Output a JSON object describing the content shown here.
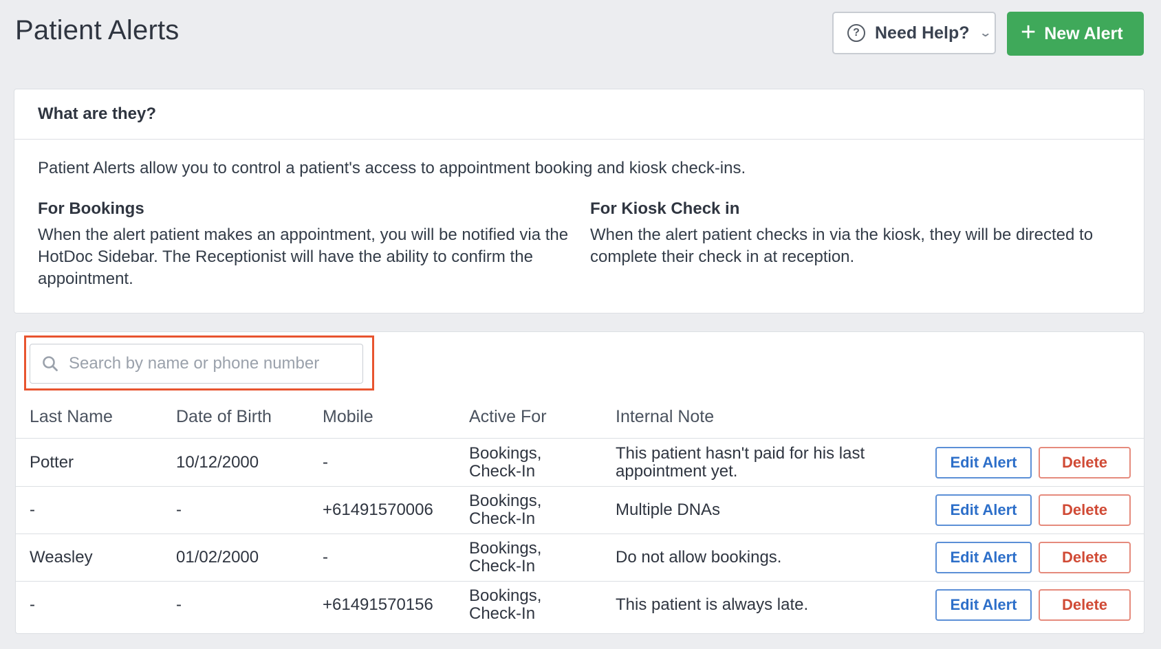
{
  "page": {
    "title": "Patient Alerts"
  },
  "header_actions": {
    "help_label": "Need Help?",
    "new_alert_label": "New Alert"
  },
  "info": {
    "header": "What are they?",
    "intro": "Patient Alerts allow you to control a patient's access to appointment booking and kiosk check-ins.",
    "bookings": {
      "heading": "For Bookings",
      "text": "When the alert patient makes an appointment, you will be notified via the HotDoc Sidebar. The Receptionist will have the ability to confirm the appointment."
    },
    "kiosk": {
      "heading": "For Kiosk Check in",
      "text": "When the alert patient checks in via the kiosk, they will be directed to complete their check in at reception."
    }
  },
  "search": {
    "placeholder": "Search by name or phone number",
    "value": ""
  },
  "table": {
    "columns": [
      "Last Name",
      "Date of Birth",
      "Mobile",
      "Active For",
      "Internal Note"
    ],
    "rows": [
      {
        "last_name": "Potter",
        "dob": "10/12/2000",
        "mobile": "-",
        "active_for": [
          "Bookings,",
          "Check-In"
        ],
        "note": "This patient hasn't paid for his last appointment yet.",
        "edit_label": "Edit Alert",
        "delete_label": "Delete"
      },
      {
        "last_name": "-",
        "dob": "-",
        "mobile": "+61491570006",
        "active_for": [
          "Bookings,",
          "Check-In"
        ],
        "note": "Multiple DNAs",
        "edit_label": "Edit Alert",
        "delete_label": "Delete"
      },
      {
        "last_name": "Weasley",
        "dob": "01/02/2000",
        "mobile": "-",
        "active_for": [
          "Bookings,",
          "Check-In"
        ],
        "note": "Do not allow bookings.",
        "edit_label": "Edit Alert",
        "delete_label": "Delete"
      },
      {
        "last_name": "-",
        "dob": "-",
        "mobile": "+61491570156",
        "active_for": [
          "Bookings,",
          "Check-In"
        ],
        "note": "This patient is always late.",
        "edit_label": "Edit Alert",
        "delete_label": "Delete"
      }
    ]
  },
  "colors": {
    "primary_green": "#3fa95a",
    "edit_blue": "#2d6fc9",
    "delete_red": "#d04a35",
    "highlight_orange": "#e8542f",
    "background": "#ecedf0"
  },
  "icons": {
    "help": "question-circle-icon",
    "dropdown": "chevron-down-icon",
    "add": "plus-icon",
    "search": "search-icon"
  }
}
